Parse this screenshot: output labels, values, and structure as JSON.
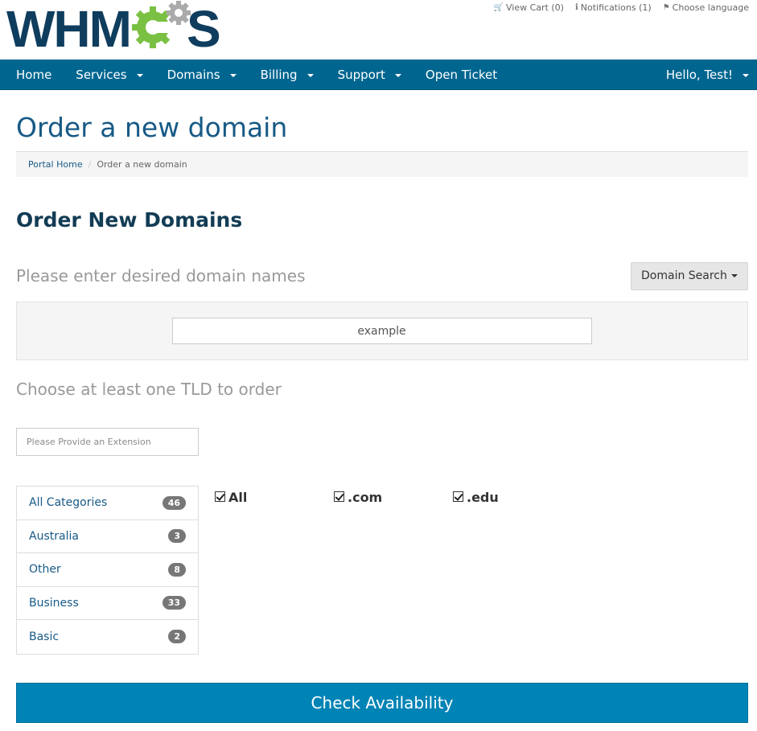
{
  "brand": {
    "logo_text": "WHMCS",
    "logo_color": "#0f3d5e",
    "gear_color": "#7ac143"
  },
  "top_links": [
    {
      "icon": "cart-icon",
      "label": "View Cart (0)"
    },
    {
      "icon": "info-icon",
      "label": "Notifications (1)"
    },
    {
      "icon": "language-icon",
      "label": "Choose language"
    }
  ],
  "navbar": {
    "bg_color": "#006690",
    "items": [
      {
        "label": "Home",
        "dropdown": false
      },
      {
        "label": "Services",
        "dropdown": true
      },
      {
        "label": "Domains",
        "dropdown": true
      },
      {
        "label": "Billing",
        "dropdown": true
      },
      {
        "label": "Support",
        "dropdown": true
      },
      {
        "label": "Open Ticket",
        "dropdown": false
      }
    ],
    "user_menu": "Hello, Test!"
  },
  "page": {
    "title": "Order a new domain",
    "breadcrumb": {
      "home": "Portal Home",
      "current": "Order a new domain"
    }
  },
  "order": {
    "heading": "Order New Domains",
    "enter_label": "Please enter desired domain names",
    "search_dropdown": "Domain Search",
    "domain_value": "example",
    "tld_label": "Choose at least one TLD to order",
    "extension_placeholder": "Please Provide an Extension",
    "categories": [
      {
        "label": "All Categories",
        "count": "46"
      },
      {
        "label": "Australia",
        "count": "3"
      },
      {
        "label": "Other",
        "count": "8"
      },
      {
        "label": "Business",
        "count": "33"
      },
      {
        "label": "Basic",
        "count": "2"
      }
    ],
    "tlds": [
      {
        "label": "All",
        "checked": true
      },
      {
        "label": ".com",
        "checked": true
      },
      {
        "label": ".edu",
        "checked": true
      }
    ],
    "submit_label": "Check Availability",
    "submit_color": "#0083b5"
  }
}
